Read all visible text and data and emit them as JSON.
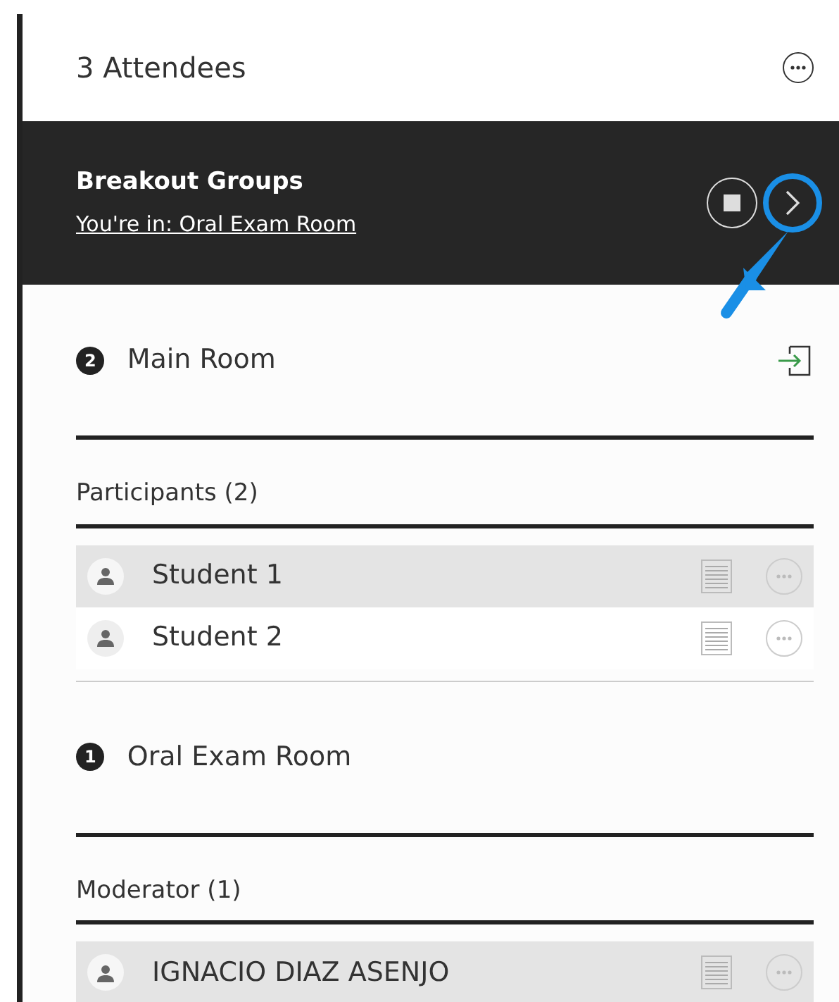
{
  "header": {
    "title": "3 Attendees"
  },
  "breakout": {
    "title": "Breakout Groups",
    "location_link": "You're in: Oral Exam Room",
    "next_highlighted": true
  },
  "groups": [
    {
      "count": "2",
      "name": "Main Room",
      "can_join": true,
      "section_title": "Participants (2)",
      "people": [
        {
          "name": "Student 1",
          "highlighted": true
        },
        {
          "name": "Student 2",
          "highlighted": false
        }
      ]
    },
    {
      "count": "1",
      "name": "Oral Exam Room",
      "can_join": false,
      "section_title": "Moderator (1)",
      "people": [
        {
          "name": "IGNACIO DIAZ ASENJO",
          "highlighted": true
        }
      ]
    }
  ]
}
